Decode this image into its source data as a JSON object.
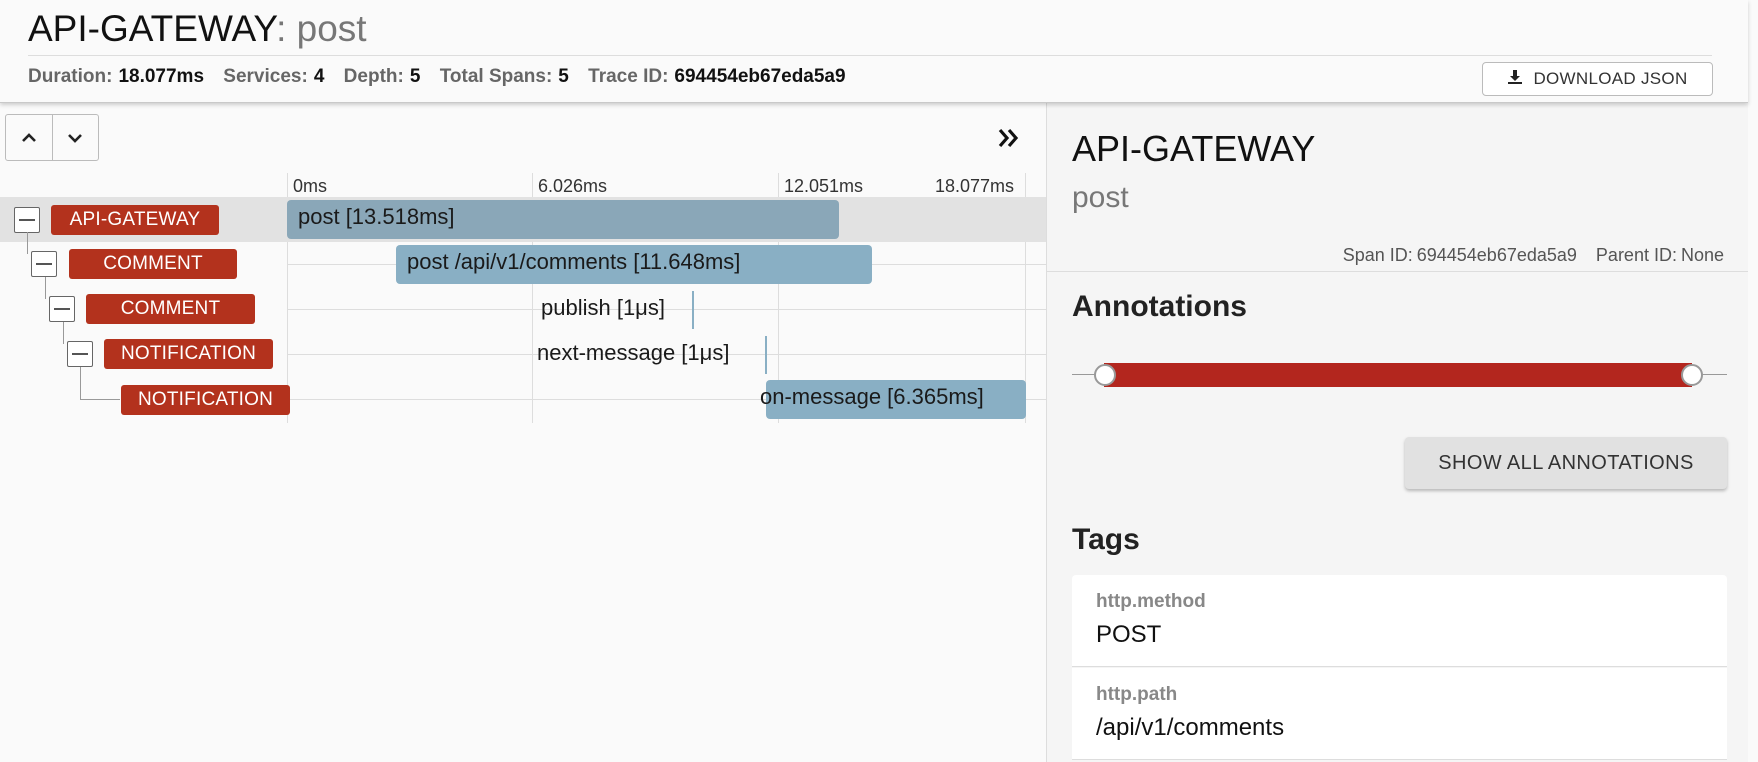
{
  "header": {
    "service": "API-GATEWAY",
    "separator": ":",
    "span_name": "post",
    "stats": {
      "duration_label": "Duration:",
      "duration": "18.077ms",
      "services_label": "Services:",
      "services": "4",
      "depth_label": "Depth:",
      "depth": "5",
      "total_spans_label": "Total Spans:",
      "total_spans": "5",
      "trace_id_label": "Trace ID:",
      "trace_id": "694454eb67eda5a9"
    },
    "download_label": "DOWNLOAD JSON"
  },
  "timeline": {
    "ticks": [
      "0ms",
      "6.026ms",
      "12.051ms",
      "18.077ms"
    ],
    "rows": [
      {
        "service": "API-GATEWAY",
        "label": "post [13.518ms]",
        "depth": 0
      },
      {
        "service": "COMMENT",
        "label": "post /api/v1/comments [11.648ms]",
        "depth": 1
      },
      {
        "service": "COMMENT",
        "label": "publish [1μs]",
        "depth": 2
      },
      {
        "service": "NOTIFICATION",
        "label": "next-message [1μs]",
        "depth": 3
      },
      {
        "service": "NOTIFICATION",
        "label": "on-message [6.365ms]",
        "depth": 4
      }
    ]
  },
  "detail": {
    "service": "API-GATEWAY",
    "span_name": "post",
    "span_id_label": "Span ID:",
    "span_id": "694454eb67eda5a9",
    "parent_id_label": "Parent ID:",
    "parent_id": "None",
    "annotations_title": "Annotations",
    "show_all_label": "SHOW ALL ANNOTATIONS",
    "tags_title": "Tags",
    "tags": [
      {
        "key": "http.method",
        "value": "POST"
      },
      {
        "key": "http.path",
        "value": "/api/v1/comments"
      }
    ]
  },
  "colors": {
    "service_badge": "#b3321d",
    "span_bar": "#89afc4",
    "annotation_bar": "#b3261e"
  },
  "icons": [
    "download-icon",
    "chevron-up-icon",
    "chevron-down-icon",
    "double-chevron-right-icon",
    "collapse-toggle-icon"
  ]
}
